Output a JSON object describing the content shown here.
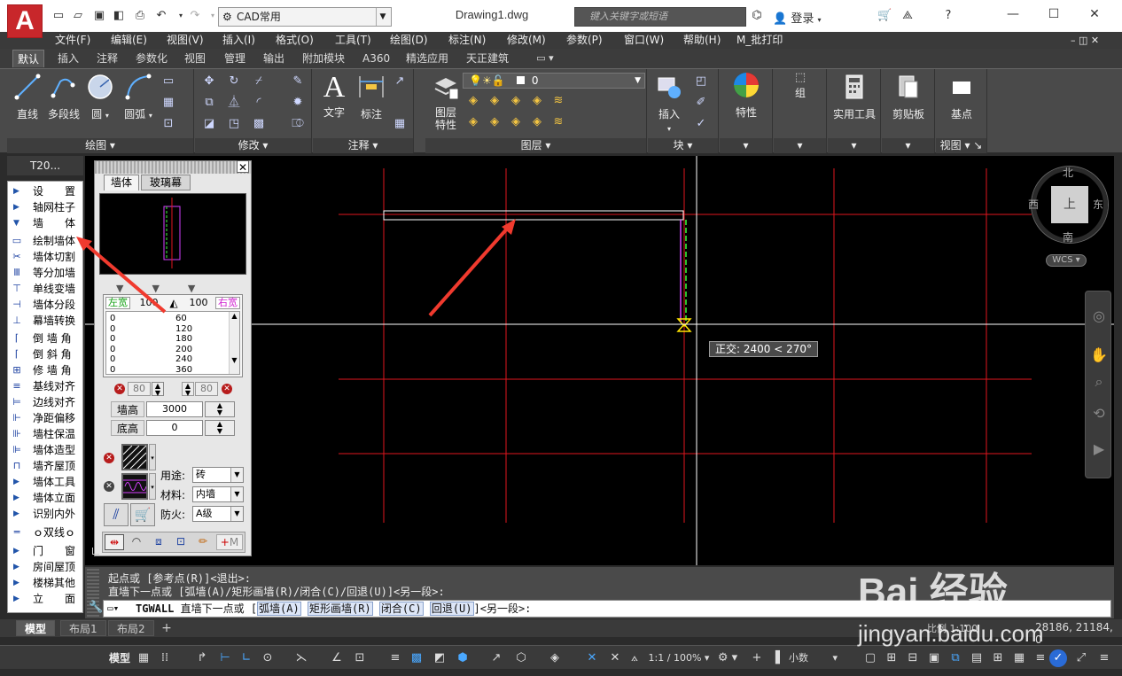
{
  "title_bar": {
    "logo": "A",
    "workspace": "CAD常用",
    "document_title": "Drawing1.dwg",
    "search_placeholder": "键入关键字或短语",
    "login": "登录"
  },
  "menu": [
    "文件(F)",
    "编辑(E)",
    "视图(V)",
    "插入(I)",
    "格式(O)",
    "工具(T)",
    "绘图(D)",
    "标注(N)",
    "修改(M)",
    "参数(P)",
    "窗口(W)",
    "帮助(H)",
    "M_批打印"
  ],
  "ribbon_tabs": [
    "默认",
    "插入",
    "注释",
    "参数化",
    "视图",
    "管理",
    "输出",
    "附加模块",
    "A360",
    "精选应用",
    "天正建筑"
  ],
  "ribbon": {
    "draw": {
      "title": "绘图",
      "line": "直线",
      "polyline": "多段线",
      "circle": "圆",
      "arc": "圆弧"
    },
    "modify": {
      "title": "修改"
    },
    "annotation": {
      "title": "注释",
      "text": "文字",
      "dimension": "标注",
      "text_glyph": "A"
    },
    "layers": {
      "title": "图层",
      "properties_line1": "图层",
      "properties_line2": "特性",
      "current_layer": "0"
    },
    "block": {
      "title": "块",
      "insert": "插入"
    },
    "properties": {
      "label": "特性"
    },
    "groups": {
      "label": "组"
    },
    "utilities": {
      "label": "实用工具"
    },
    "clipboard": {
      "label": "剪贴板"
    },
    "view": {
      "title": "视图",
      "basepoint": "基点"
    }
  },
  "t20": {
    "header": "T20...",
    "items": [
      {
        "label": "设　　置",
        "type": "folder"
      },
      {
        "label": "轴网柱子",
        "type": "folder"
      },
      {
        "label": "墙　　体",
        "type": "open"
      },
      {
        "label": "绘制墙体",
        "type": "cmd"
      },
      {
        "label": "墙体切割",
        "type": "cmd"
      },
      {
        "label": "等分加墙",
        "type": "cmd"
      },
      {
        "label": "单线变墙",
        "type": "cmd"
      },
      {
        "label": "墙体分段",
        "type": "cmd"
      },
      {
        "label": "幕墙转换",
        "type": "cmd"
      },
      {
        "label": "倒 墙 角",
        "type": "cmd"
      },
      {
        "label": "倒 斜 角",
        "type": "cmd"
      },
      {
        "label": "修 墙 角",
        "type": "cmd"
      },
      {
        "label": "基线对齐",
        "type": "cmd"
      },
      {
        "label": "边线对齐",
        "type": "cmd"
      },
      {
        "label": "净距偏移",
        "type": "cmd"
      },
      {
        "label": "墙柱保温",
        "type": "cmd"
      },
      {
        "label": "墙体造型",
        "type": "cmd"
      },
      {
        "label": "墙齐屋顶",
        "type": "cmd"
      },
      {
        "label": "墙体工具",
        "type": "folder"
      },
      {
        "label": "墙体立面",
        "type": "folder"
      },
      {
        "label": "识别内外",
        "type": "folder"
      },
      {
        "label": "ｏ双线ｏ",
        "type": "cmd"
      },
      {
        "label": "门　　窗",
        "type": "folder"
      },
      {
        "label": "房间屋顶",
        "type": "folder"
      },
      {
        "label": "楼梯其他",
        "type": "folder"
      },
      {
        "label": "立　　面",
        "type": "folder"
      }
    ]
  },
  "wall_dialog": {
    "tabs": [
      "墙体",
      "玻璃幕"
    ],
    "left_width_label": "左宽",
    "right_width_label": "右宽",
    "left_width": "100",
    "right_width": "100",
    "list": [
      {
        "left": "0",
        "right": "60"
      },
      {
        "left": "0",
        "right": "120"
      },
      {
        "left": "0",
        "right": "180"
      },
      {
        "left": "0",
        "right": "200"
      },
      {
        "left": "0",
        "right": "240"
      },
      {
        "left": "0",
        "right": "360"
      }
    ],
    "spin_left": "80",
    "spin_right": "80",
    "wall_height_label": "墙高",
    "wall_height": "3000",
    "base_height_label": "底高",
    "base_height": "0",
    "usage_label": "用途:",
    "usage": "砖",
    "material_label": "材料:",
    "material": "内墙",
    "fire_label": "防火:",
    "fire": "A级",
    "mode_m": "M"
  },
  "canvas": {
    "ortho_tooltip": "正交: 2400 < 270°",
    "viewcube": {
      "north": "北",
      "south": "南",
      "east": "东",
      "west": "西",
      "top": "上",
      "wcs": "WCS"
    }
  },
  "command": {
    "history": [
      "起点或 [参考点(R)]<退出>:",
      "直墙下一点或 [弧墙(A)/矩形画墙(R)/闭合(C)/回退(U)]<另一段>:"
    ],
    "prompt_cmd": "TGWALL",
    "prompt_text": "直墙下一点或 [",
    "options": [
      "弧墙(A)",
      "矩形画墙(R)",
      "闭合(C)",
      "回退(U)"
    ],
    "prompt_end": "]<另一段>:"
  },
  "layout_tabs": [
    "模型",
    "布局1",
    "布局2"
  ],
  "status": {
    "model": "模型",
    "scale": "1:1 / 100%",
    "units": "小数",
    "ratio": "比例 1:100",
    "coords": "28186, 21184, 0"
  },
  "watermark": {
    "text": "jingyan.baidu.com",
    "brand": "Bai 经验"
  },
  "colors": {
    "accent": "#c8272b",
    "grid": "#e0161e",
    "canvas": "#000000"
  }
}
